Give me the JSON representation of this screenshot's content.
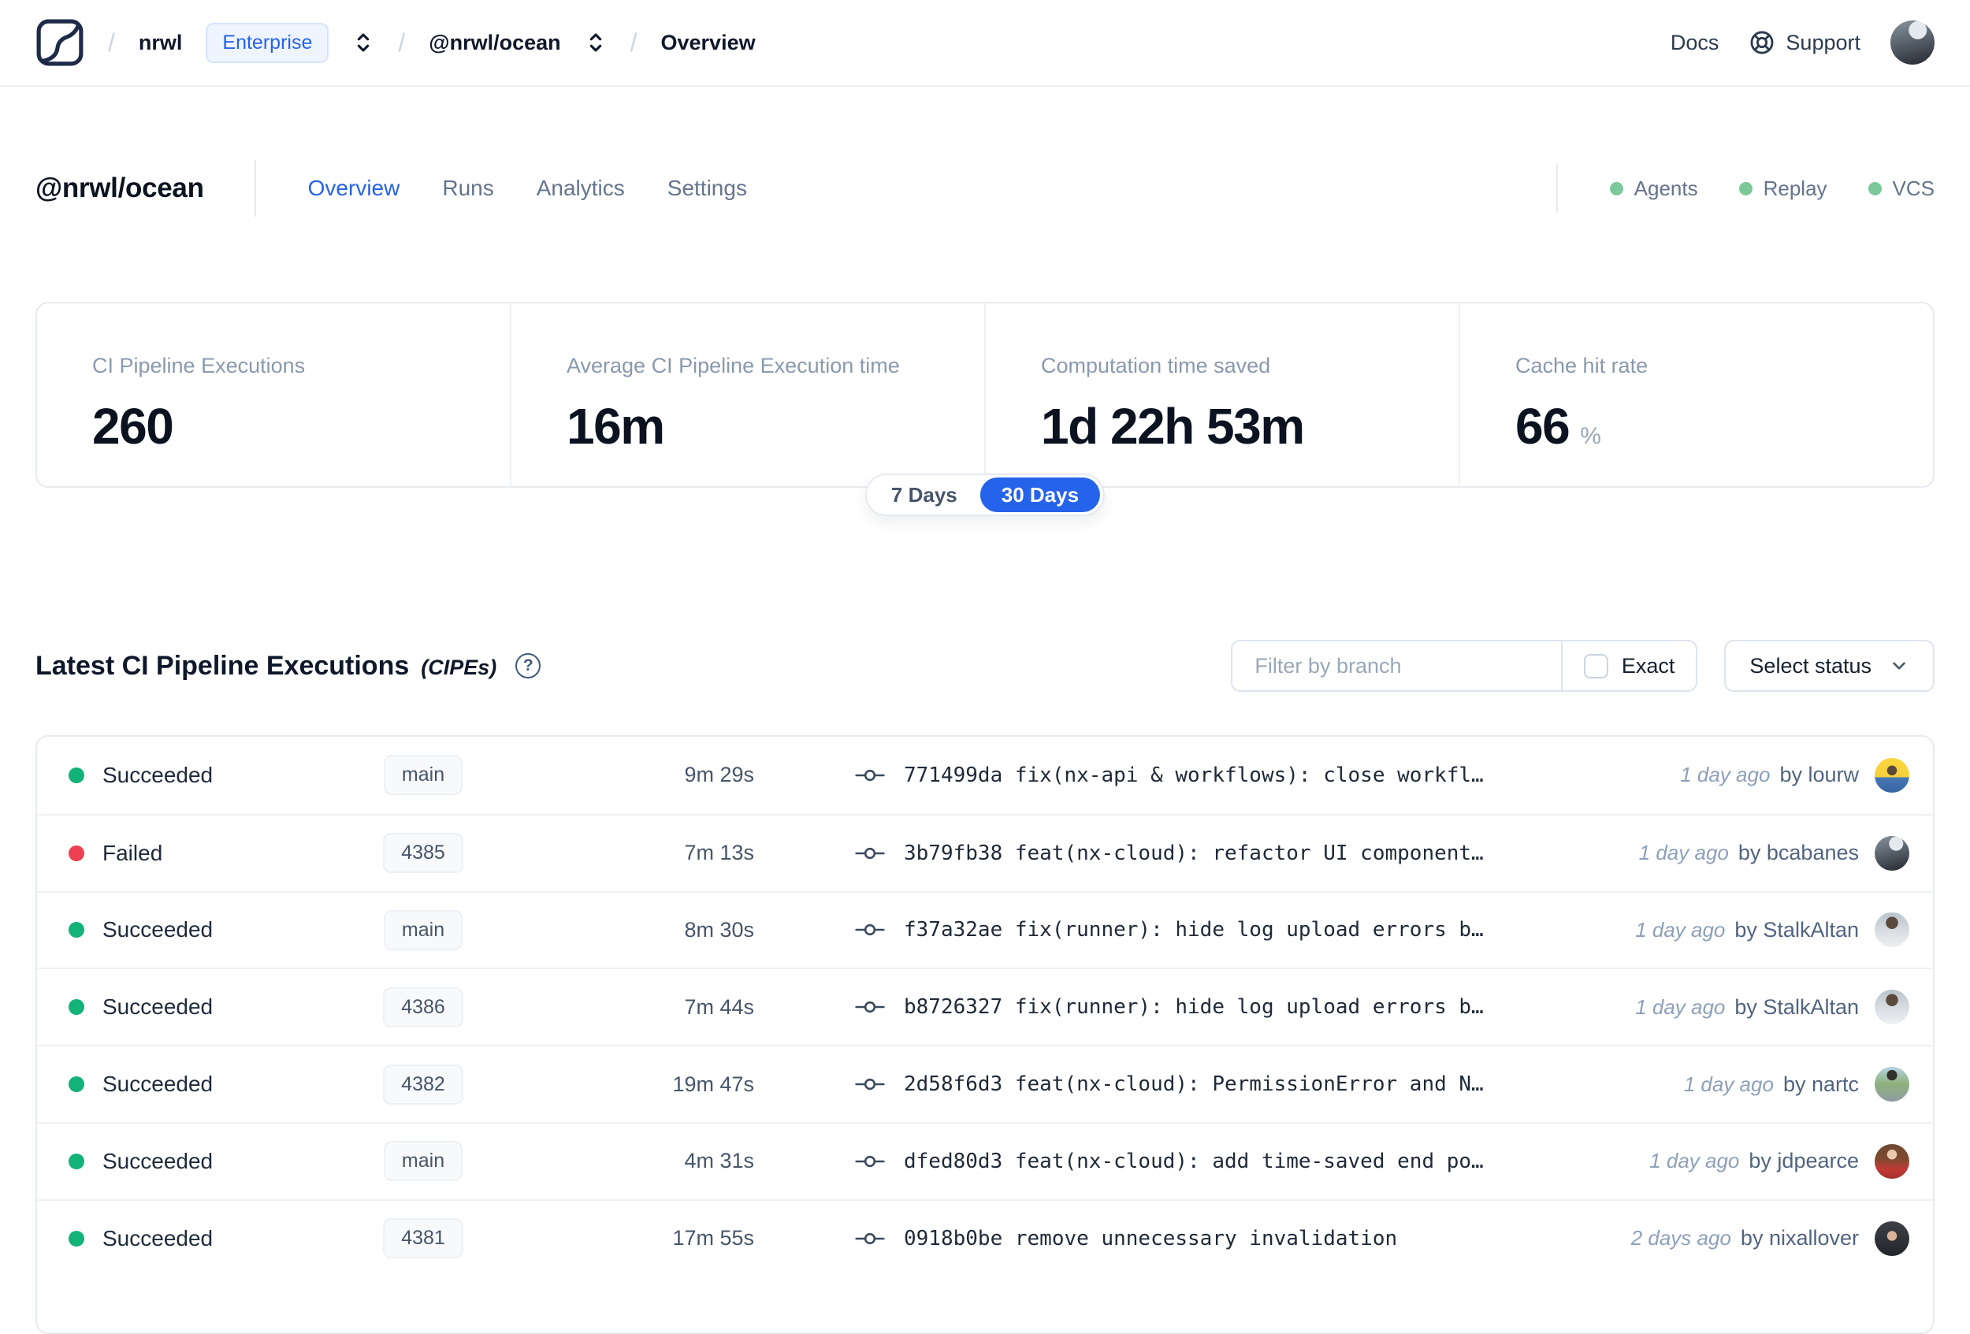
{
  "navbar": {
    "breadcrumb": {
      "separator": "/",
      "org": "nrwl",
      "org_badge": "Enterprise",
      "workspace": "@nrwl/ocean",
      "page": "Overview"
    },
    "links": {
      "docs": "Docs",
      "support": "Support"
    }
  },
  "header": {
    "title": "@nrwl/ocean",
    "tabs": [
      {
        "label": "Overview",
        "active": true
      },
      {
        "label": "Runs",
        "active": false
      },
      {
        "label": "Analytics",
        "active": false
      },
      {
        "label": "Settings",
        "active": false
      }
    ],
    "indicators": [
      {
        "label": "Agents",
        "status_color": "#7bc89a"
      },
      {
        "label": "Replay",
        "status_color": "#7bc89a"
      },
      {
        "label": "VCS",
        "status_color": "#7bc89a"
      }
    ]
  },
  "stats": {
    "cards": [
      {
        "label": "CI Pipeline Executions",
        "value": "260",
        "suffix": ""
      },
      {
        "label": "Average CI Pipeline Execution time",
        "value": "16m",
        "suffix": ""
      },
      {
        "label": "Computation time saved",
        "value": "1d 22h 53m",
        "suffix": ""
      },
      {
        "label": "Cache hit rate",
        "value": "66",
        "suffix": "%"
      }
    ]
  },
  "range_toggle": {
    "options": [
      {
        "label": "7 Days",
        "active": false
      },
      {
        "label": "30 Days",
        "active": true
      }
    ]
  },
  "section": {
    "title": "Latest CI Pipeline Executions",
    "subtitle": "(CIPEs)",
    "help_glyph": "?"
  },
  "filters": {
    "branch_placeholder": "Filter by branch",
    "branch_value": "",
    "exact_label": "Exact",
    "exact_checked": false,
    "status_label": "Select status"
  },
  "table": {
    "rows": [
      {
        "status": "Succeeded",
        "branch": "main",
        "duration": "9m 29s",
        "commit": "771499da fix(nx-api & workflows): close workfl…",
        "time": "1 day ago",
        "author": "by lourw",
        "avatar": "lourw"
      },
      {
        "status": "Failed",
        "branch": "4385",
        "duration": "7m 13s",
        "commit": "3b79fb38 feat(nx-cloud): refactor UI component…",
        "time": "1 day ago",
        "author": "by bcabanes",
        "avatar": "bcabanes"
      },
      {
        "status": "Succeeded",
        "branch": "main",
        "duration": "8m 30s",
        "commit": "f37a32ae fix(runner): hide log upload errors b…",
        "time": "1 day ago",
        "author": "by StalkAltan",
        "avatar": "stalkaltan"
      },
      {
        "status": "Succeeded",
        "branch": "4386",
        "duration": "7m 44s",
        "commit": "b8726327 fix(runner): hide log upload errors b…",
        "time": "1 day ago",
        "author": "by StalkAltan",
        "avatar": "stalkaltan"
      },
      {
        "status": "Succeeded",
        "branch": "4382",
        "duration": "19m 47s",
        "commit": "2d58f6d3 feat(nx-cloud): PermissionError and N…",
        "time": "1 day ago",
        "author": "by nartc",
        "avatar": "nartc"
      },
      {
        "status": "Succeeded",
        "branch": "main",
        "duration": "4m 31s",
        "commit": "dfed80d3 feat(nx-cloud): add time-saved end po…",
        "time": "1 day ago",
        "author": "by jdpearce",
        "avatar": "jdpearce"
      },
      {
        "status": "Succeeded",
        "branch": "4381",
        "duration": "17m 55s",
        "commit": "0918b0be remove unnecessary invalidation",
        "time": "2 days ago",
        "author": "by nixallover",
        "avatar": "nixallover"
      }
    ]
  },
  "colors": {
    "accent": "#2563eb",
    "succeeded": "#12b279",
    "failed": "#ee4050",
    "indicator_green": "#7bc89a"
  },
  "icons": {
    "logo": "nx-cloud-logo",
    "breadcrumb_expand": "chevron-up-down",
    "support": "lifebuoy",
    "help": "question-circle",
    "commit": "git-commit",
    "status_dropdown": "chevron-down"
  }
}
